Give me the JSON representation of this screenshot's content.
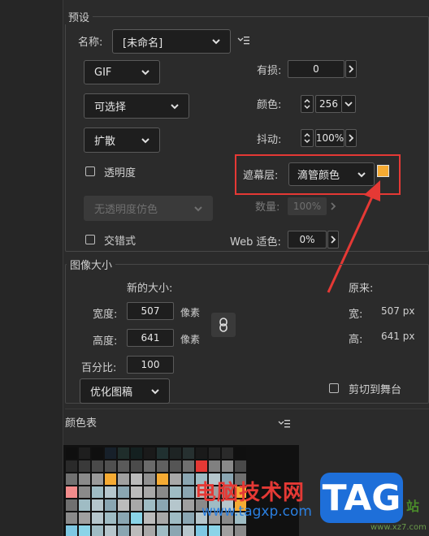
{
  "preset": {
    "group_title": "预设",
    "name_label": "名称:",
    "name_value": "[未命名]",
    "format_value": "GIF",
    "palette_value": "可选择",
    "dither_value": "扩散",
    "transparency_label": "透明度",
    "transparency_dither_value": "无透明度仿色",
    "interlaced_label": "交错式",
    "lossy_label": "有损:",
    "lossy_value": "0",
    "colors_label": "颜色:",
    "colors_value": "256",
    "dither_amount_label": "抖动:",
    "dither_amount_value": "100%",
    "matte_label": "遮幕层:",
    "matte_value": "滴管颜色",
    "matte_color": "#f6ab33",
    "amount_label": "数量:",
    "amount_value": "100%",
    "web_snap_label": "Web 适色:",
    "web_snap_value": "0%"
  },
  "image_size": {
    "group_title": "图像大小",
    "new_size_label": "新的大小:",
    "width_label": "宽度:",
    "width_value": "507",
    "height_label": "高度:",
    "height_value": "641",
    "unit_label": "像素",
    "percent_label": "百分比:",
    "percent_value": "100",
    "quality_value": "优化图稿",
    "original_label": "原来:",
    "orig_width_label": "宽:",
    "orig_width_value": "507 px",
    "orig_height_label": "高:",
    "orig_height_value": "641 px",
    "clip_label": "剪切到舞台"
  },
  "color_table": {
    "title": "颜色表",
    "rows": [
      [
        "#0f0f0f",
        "#1e1e1e",
        "#0f0f0f",
        "#17202a",
        "#1f2d2b",
        "#142020",
        "#1a1a1a",
        "#203030",
        "#1e2424",
        "#263030",
        "#1a1a1a",
        "#242424",
        "#2a2a2a",
        "#101010"
      ],
      [
        "#2a2a2a",
        "#3a3a3a",
        "#4a4a4a",
        "#505050",
        "#5a5a5a",
        "#4b4b4b",
        "#6a6a6a",
        "#606060",
        "#555555",
        "#707070",
        "#e53935",
        "#808080",
        "#8a8a8a",
        "#4a4a4a"
      ],
      [
        "#707070",
        "#8a8a8a",
        "#9a9a9a",
        "#f6ab33",
        "#a0a0a0",
        "#bbbbbb",
        "#909090",
        "#f6ab33",
        "#a8a8a8",
        "#8aa6b2",
        "#9fbcc4",
        "#b5c6cc",
        "#8aa6b2",
        "#707070"
      ],
      [
        "#f28c8c",
        "#8a8a8a",
        "#9fbcc4",
        "#b5c6cc",
        "#8aa6b2",
        "#bbbbbb",
        "#a8a8a8",
        "#8a8a8a",
        "#9fbcc4",
        "#8aa6b2",
        "#bbbbbb",
        "#a0a0a0",
        "#8a8a8a",
        "#f6ab33"
      ],
      [
        "#707070",
        "#9fbcc4",
        "#b5c6cc",
        "#8aa6b2",
        "#bbbbbb",
        "#a8a8a8",
        "#9fbcc4",
        "#8aa6b2",
        "#b5c6cc",
        "#a0a0a0",
        "#8a8a8a",
        "#9fbcc4",
        "#b5c6cc",
        "#f6ab33"
      ],
      [
        "#8a8a8a",
        "#a0a0a0",
        "#b5c6cc",
        "#9fbcc4",
        "#8aa6b2",
        "#8ad4e8",
        "#bbbbbb",
        "#a8a8a8",
        "#9fbcc4",
        "#8aa6b2",
        "#b5c6cc",
        "#a0a0a0",
        "#8a8a8a",
        "#9fbcc4"
      ],
      [
        "#7ec8e3",
        "#8ad4e8",
        "#9fbcc4",
        "#b5c6cc",
        "#8aa6b2",
        "#bbbbbb",
        "#a8a8a8",
        "#9fbcc4",
        "#8aa6b2",
        "#b5c6cc",
        "#7ec8e3",
        "#8ad4e8",
        "#a0a0a0",
        "#8a8a8a"
      ],
      [
        "#9fbcc4",
        "#8aa6b2",
        "#b5c6cc",
        "#a0a0a0",
        "#8ad4e8",
        "#7ec8e3",
        "#bbbbbb",
        "#a8a8a8",
        "#9fbcc4",
        "#8aa6b2",
        "#b5c6cc",
        "#a0a0a0",
        "#8a8a8a",
        "#9fbcc4"
      ]
    ]
  },
  "watermark": {
    "site_cn": "电脑技术网",
    "site_url": "www.tagxp.com",
    "badge": "TAG",
    "corner_text": "站",
    "corner_url": "www.xz7.com"
  }
}
